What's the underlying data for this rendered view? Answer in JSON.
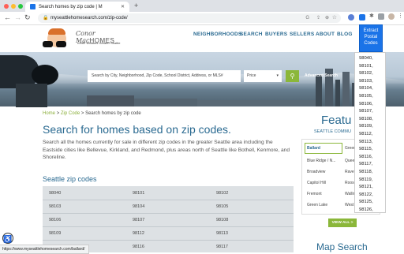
{
  "browser": {
    "tab_title": "Search homes by zip code | M",
    "url": "myseattlehomesearch.com/zip-code/"
  },
  "site": {
    "logo_name_first": "Conor Mac",
    "logo_name_second": "HOMES",
    "logo_sub": "Keller Williams Greater Seattle",
    "nav": [
      "NEIGHBORHOODS",
      "SEARCH",
      "BUYERS",
      "SELLERS",
      "ABOUT",
      "BLOG"
    ]
  },
  "hero": {
    "search_placeholder": "Search by City, Neighborhood, Zip Code, School District, Address, or MLS#",
    "price_label": "Price",
    "advanced_search": "Advanced Search"
  },
  "breadcrumb": [
    "Home",
    "Zip Code",
    "Search homes by zip code"
  ],
  "main": {
    "title": "Search for homes based on zip codes.",
    "intro": "Search all the homes currently for sale in different zip codes in the greater Seattle area including the Eastside cities like Bellevue, Kirkland, and Redmond, plus areas north of Seattle like Bothell, Kenmore, and Shoreline.",
    "zip_heading": "Seattle zip codes",
    "zip_rows": [
      [
        "98040",
        "98101",
        "98102"
      ],
      [
        "98103",
        "98104",
        "98105"
      ],
      [
        "98106",
        "98107",
        "98108"
      ],
      [
        "98109",
        "98112",
        "98113"
      ],
      [
        "98115",
        "98116",
        "98117"
      ]
    ]
  },
  "featured": {
    "title": "Featu",
    "subtitle": "SEATTLE COMMU",
    "col1": [
      "Ballard",
      "Blue Ridge / N...",
      "Broadview",
      "Capitol Hill",
      "Fremont",
      "Green Lake"
    ],
    "col2": [
      "Green",
      "Queer",
      "Ravenn",
      "Roose",
      "Walling",
      "West S"
    ],
    "view_all": "VIEW ALL >",
    "map_search": "Map Search"
  },
  "extension": {
    "button_label": [
      "Extract",
      "Postal",
      "Codes"
    ],
    "codes": [
      "98040,",
      "98101,",
      "98102,",
      "98103,",
      "98104,",
      "98105,",
      "98106,",
      "98107,",
      "98108,",
      "98109,",
      "98112,",
      "98113,",
      "98115,",
      "98116,",
      "98117,",
      "98118,",
      "98119,",
      "98121,",
      "98122,",
      "98125,",
      "98126,"
    ]
  },
  "status_url": "https://www.myseattlehomesearch.com/ballard/"
}
